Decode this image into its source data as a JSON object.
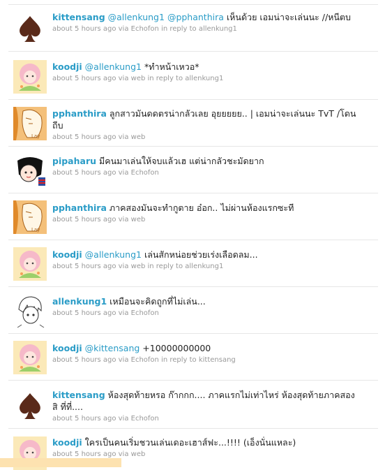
{
  "tweets": [
    {
      "author": "kittensang",
      "mention": "@allenkung1",
      "mention2": "@pphanthira",
      "text": "เห็นด้วย เอมน่าจะเล่นนะ //หนีตบ",
      "meta": "about 5 hours ago via Echofon in reply to allenkung1",
      "avatar": "spade"
    },
    {
      "author": "koodji",
      "mention": "@allenkung1",
      "mention2": "",
      "text": "*ทำหน้าเหวอ*",
      "meta": "about 5 hours ago via web in reply to allenkung1",
      "avatar": "anime-pink"
    },
    {
      "author": "pphanthira",
      "mention": "",
      "mention2": "",
      "text": "ลูกสาวมันดดตรน่ากลัวเลย อุยยยยย.. | เอมน่าจะเล่นนะ TvT /โดนถีบ",
      "meta": "about 5 hours ago via web",
      "avatar": "orange-sketch"
    },
    {
      "author": "pipaharu",
      "mention": "",
      "mention2": "",
      "text": "มีคนมาเล่นให้จบแล้วเฮ แต่น่ากลัวชะมัดยาก",
      "meta": "about 5 hours ago via Echofon",
      "avatar": "manga-face"
    },
    {
      "author": "pphanthira",
      "mention": "",
      "mention2": "",
      "text": "ภาคสองมันจะทำกูตาย อ๋อก.. ไม่ผ่านห้องแรกซะที",
      "meta": "about 5 hours ago via web",
      "avatar": "orange-sketch"
    },
    {
      "author": "koodji",
      "mention": "@allenkung1",
      "mention2": "",
      "text": "เล่นสักหน่อยช่วยเร่งเลือดลม...",
      "meta": "about 5 hours ago via web in reply to allenkung1",
      "avatar": "anime-pink"
    },
    {
      "author": "allenkung1",
      "mention": "",
      "mention2": "",
      "text": "เหมือนจะคิดถูกที่ไม่เล่น...",
      "meta": "about 5 hours ago via Echofon",
      "avatar": "bw-sketch"
    },
    {
      "author": "koodji",
      "mention": "@kittensang",
      "mention2": "",
      "text": "+10000000000",
      "meta": "about 5 hours ago via Echofon in reply to kittensang",
      "avatar": "anime-pink"
    },
    {
      "author": "kittensang",
      "mention": "",
      "mention2": "",
      "text": "ห้องสุดท้ายหรอ ก๊ากกก.... ภาคแรกไม่เท่าไหร่ ห้องสุดท้ายภาคสองสิ ที่ที่....",
      "meta": "about 5 hours ago via Echofon",
      "avatar": "spade"
    },
    {
      "author": "koodji",
      "mention": "",
      "mention2": "",
      "text": "ใครเป็นคนเริ่มชวนเล่นเดอะเฮาส์ฟะ...!!!! (เอ็งนั่นแหละ)",
      "meta": "about 5 hours ago via web",
      "avatar": "anime-pink"
    }
  ],
  "colors": {
    "link": "#2a9cc7",
    "meta": "#999999",
    "text": "#222222",
    "divider": "#e6e6e6"
  }
}
